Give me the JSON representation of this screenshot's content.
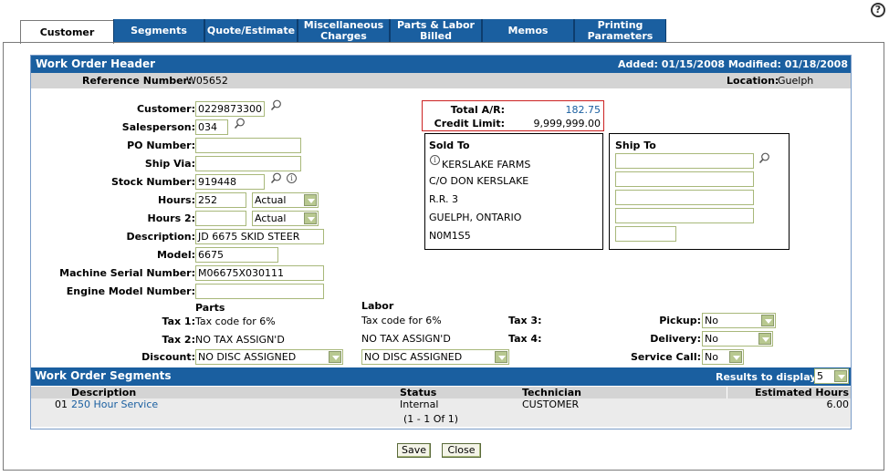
{
  "help_icon": "?",
  "tabs": [
    {
      "label": "Customer",
      "active": true
    },
    {
      "label": "Segments"
    },
    {
      "label": "Quote/Estimate"
    },
    {
      "label": "Miscellaneous Charges"
    },
    {
      "label": "Parts & Labor Billed"
    },
    {
      "label": "Memos"
    },
    {
      "label": "Printing Parameters"
    }
  ],
  "header": {
    "title": "Work Order Header",
    "dates": "Added: 01/15/2008 Modified: 01/18/2008",
    "reference_label": "Reference Number:",
    "reference_value": "W05652",
    "location_label": "Location:",
    "location_value": "Guelph"
  },
  "form": {
    "customer_label": "Customer:",
    "customer_value": "0229873300",
    "salesperson_label": "Salesperson:",
    "salesperson_value": "034",
    "po_label": "PO Number:",
    "po_value": "",
    "shipvia_label": "Ship Via:",
    "shipvia_value": "",
    "stock_label": "Stock Number:",
    "stock_value": "919448",
    "hours_label": "Hours:",
    "hours_value": "252",
    "hours_type": "Actual",
    "hours2_label": "Hours 2:",
    "hours2_value": "",
    "hours2_type": "Actual",
    "description_label": "Description:",
    "description_value": "JD 6675 SKID STEER",
    "model_label": "Model:",
    "model_value": "6675",
    "serial_label": "Machine Serial Number:",
    "serial_value": "M06675X030111",
    "engine_label": "Engine Model Number:",
    "engine_value": ""
  },
  "credit": {
    "total_ar_label": "Total A/R:",
    "total_ar_value": "182.75",
    "limit_label": "Credit Limit:",
    "limit_value": "9,999,999.00"
  },
  "sold_to": {
    "title": "Sold To",
    "lines": [
      "KERSLAKE FARMS",
      "C/O DON KERSLAKE",
      "R.R. 3",
      "GUELPH, ONTARIO",
      "N0M1S5"
    ]
  },
  "ship_to": {
    "title": "Ship To"
  },
  "tax": {
    "parts_heading": "Parts",
    "labor_heading": "Labor",
    "tax1_label": "Tax 1:",
    "tax1_parts": "Tax code for 6%",
    "tax1_labor": "Tax code for 6%",
    "tax2_label": "Tax 2:",
    "tax2_parts": "NO TAX ASSIGN'D",
    "tax2_labor": "NO TAX ASSIGN'D",
    "tax3_label": "Tax 3:",
    "tax4_label": "Tax 4:",
    "discount_label": "Discount:",
    "discount_parts": "NO DISC ASSIGNED",
    "discount_labor": "NO DISC ASSIGNED",
    "pickup_label": "Pickup:",
    "pickup_value": "No",
    "delivery_label": "Delivery:",
    "delivery_value": "No",
    "service_label": "Service Call:",
    "service_value": "No"
  },
  "segments": {
    "title": "Work Order Segments",
    "results_label": "Results to display:",
    "results_value": "5",
    "columns": [
      "Description",
      "Status",
      "Technician",
      "Estimated Hours"
    ],
    "rows": [
      {
        "num": "01",
        "description": "250 Hour Service",
        "status": "Internal",
        "technician": "CUSTOMER",
        "hours": "6.00"
      }
    ],
    "pager": "(1 - 1 Of 1)"
  },
  "buttons": {
    "save": "Save",
    "close": "Close"
  },
  "colors": {
    "accent": "#1a5fa0",
    "link": "#1a5fa0",
    "field_border": "#a8b87a"
  }
}
